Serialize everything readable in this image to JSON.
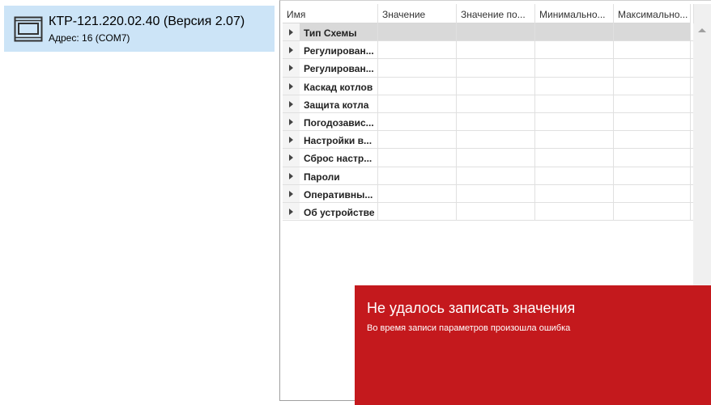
{
  "device": {
    "title": "КТР-121.220.02.40 (Версия 2.07)",
    "address": "Адрес: 16 (COM7)",
    "icon": "device-icon"
  },
  "grid": {
    "columns": [
      "Имя",
      "Значение",
      "Значение по...",
      "Минимально...",
      "Максимально..."
    ],
    "rows": [
      {
        "name": "Тип Схемы",
        "selected": true
      },
      {
        "name": "Регулирован...",
        "selected": false
      },
      {
        "name": "Регулирован...",
        "selected": false
      },
      {
        "name": "Каскад котлов",
        "selected": false
      },
      {
        "name": "Защита котла",
        "selected": false
      },
      {
        "name": "Погодозавис...",
        "selected": false
      },
      {
        "name": "Настройки в...",
        "selected": false
      },
      {
        "name": "Сброс настр...",
        "selected": false
      },
      {
        "name": "Пароли",
        "selected": false
      },
      {
        "name": "Оперативны...",
        "selected": false
      },
      {
        "name": "Об устройстве",
        "selected": false
      }
    ]
  },
  "toast": {
    "title": "Не удалось записать значения",
    "message": "Во время записи параметров произошла ошибка",
    "color": "#c4191d"
  },
  "colors": {
    "selection": "#cce4f7"
  }
}
